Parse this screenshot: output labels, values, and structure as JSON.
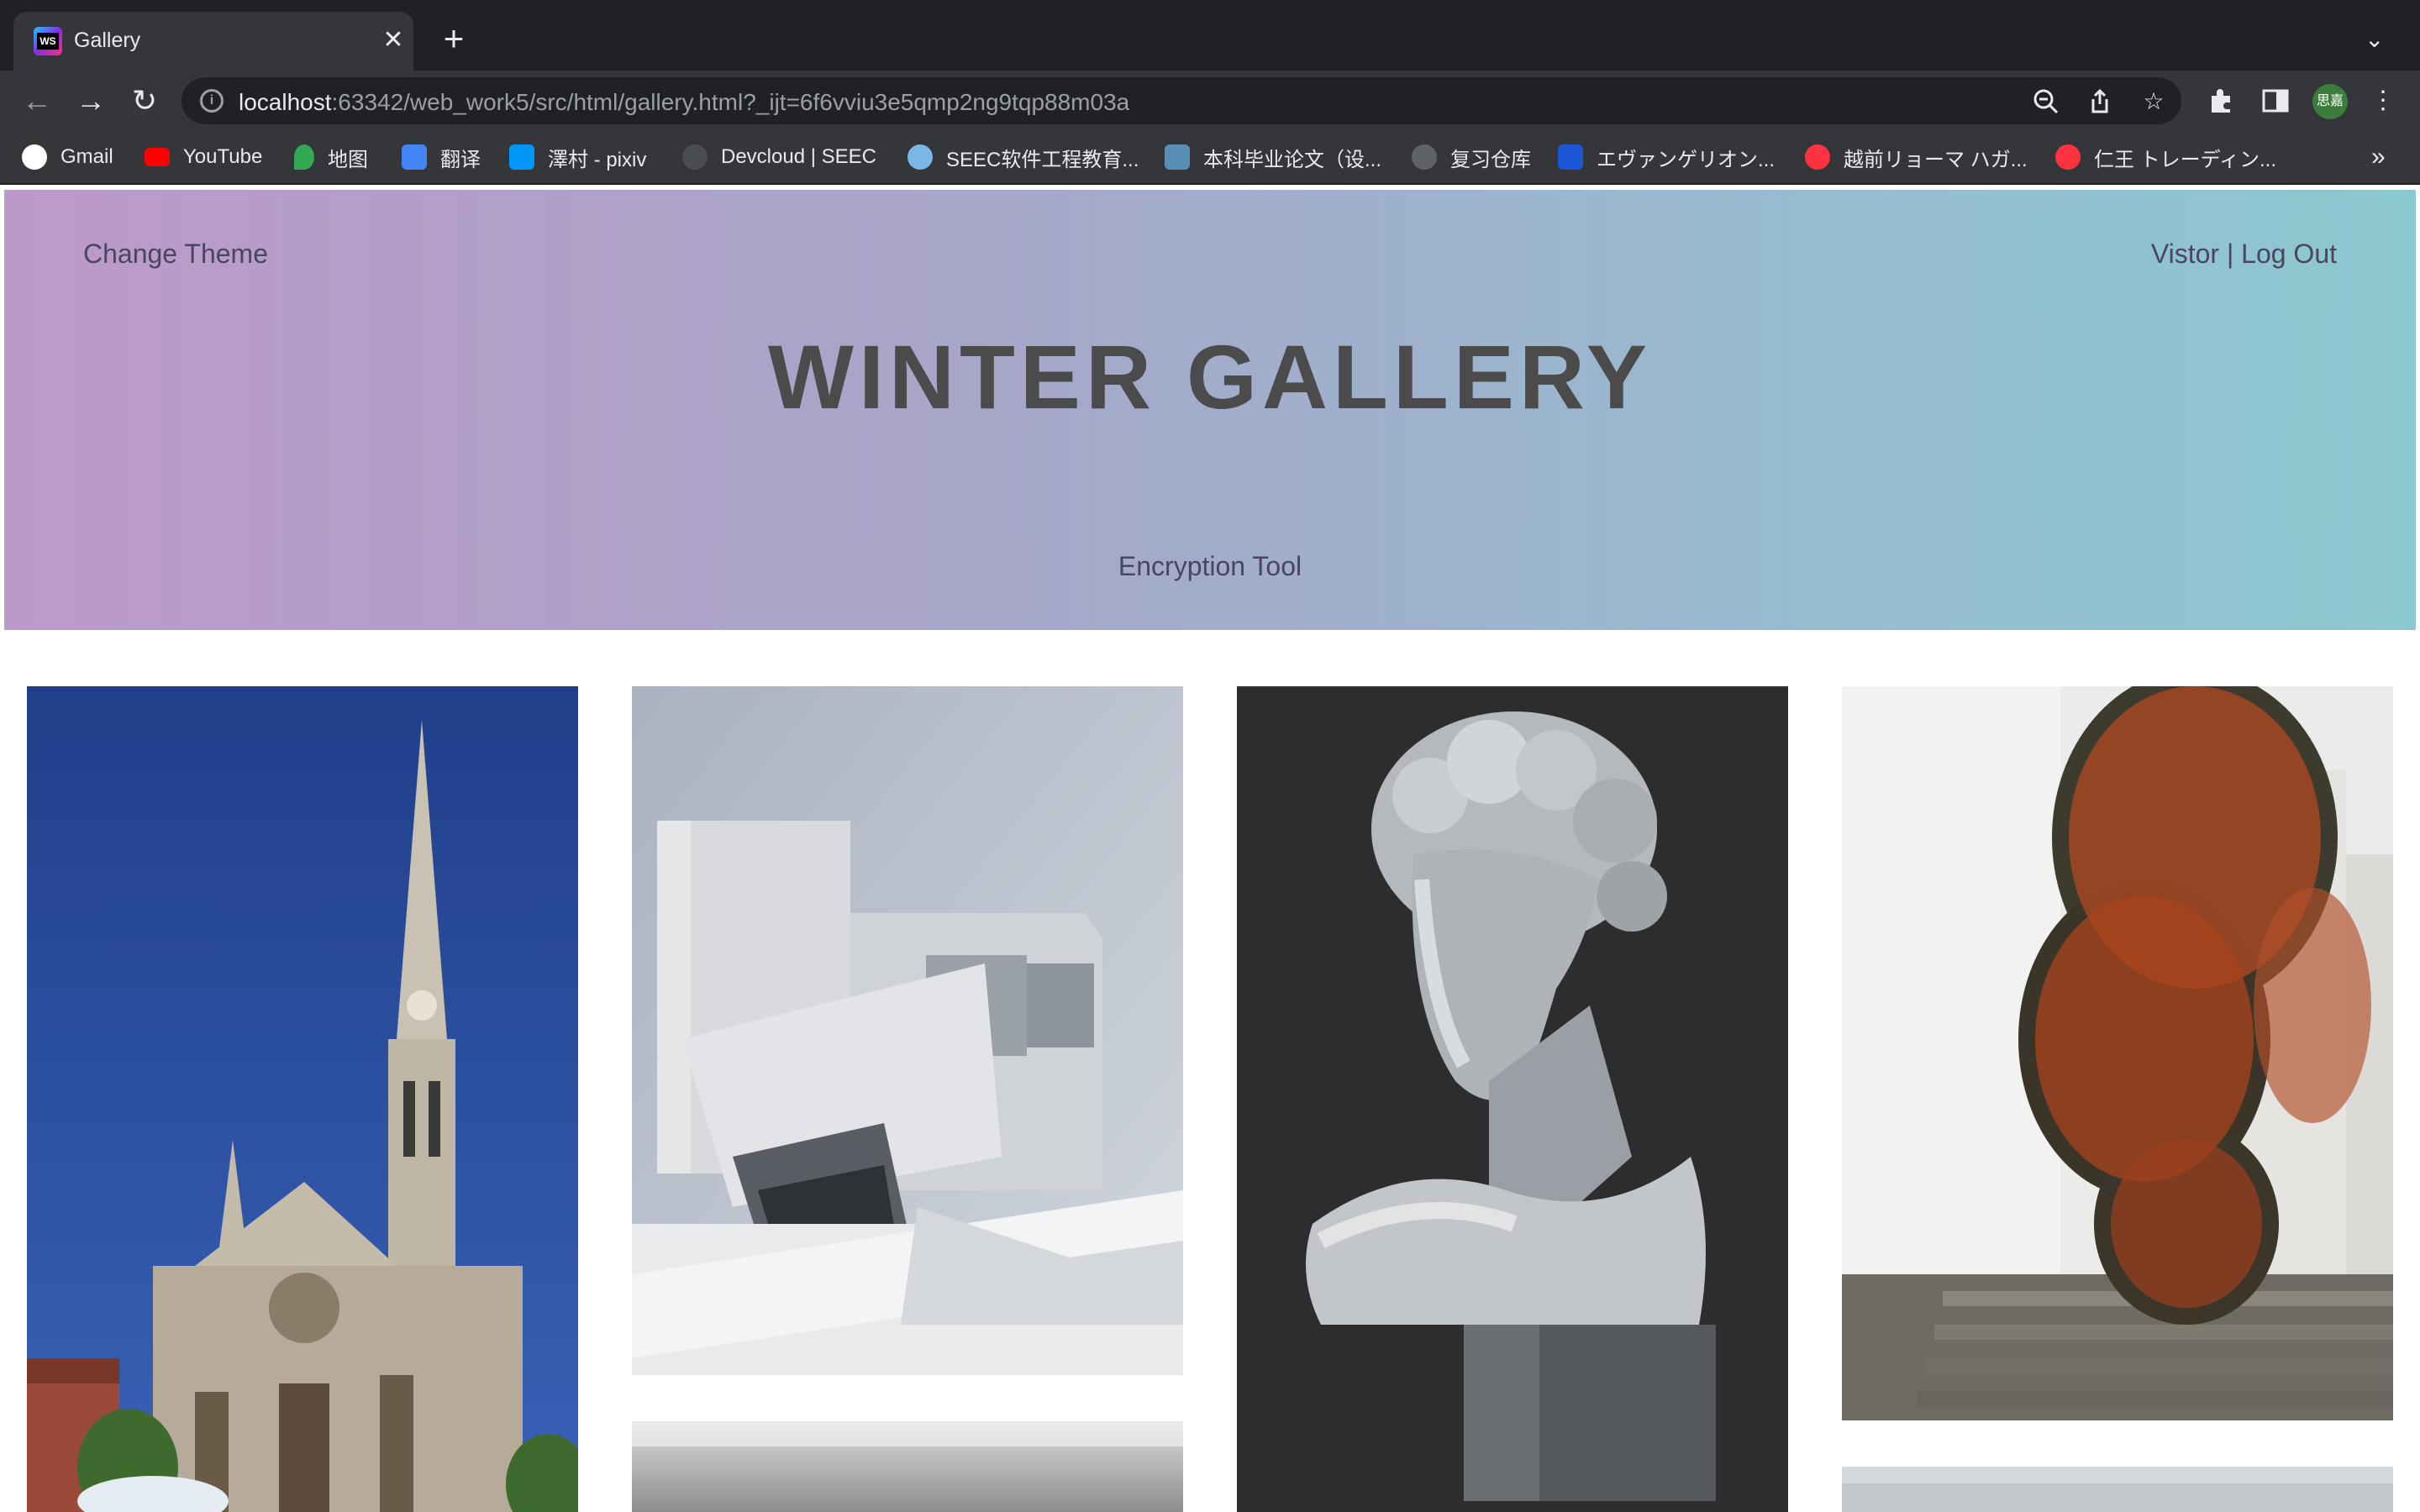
{
  "browser": {
    "tab_title": "Gallery",
    "url_host": "localhost",
    "url_rest": ":63342/web_work5/src/html/gallery.html?_ijt=6f6vviu3e5qmp2ng9tqp88m03a",
    "profile_label": "思嘉",
    "bookmarks": [
      {
        "label": "Gmail",
        "icon": "google-icon",
        "color": "#ffffff"
      },
      {
        "label": "YouTube",
        "icon": "youtube-icon",
        "color": "#ff0000"
      },
      {
        "label": "地图",
        "icon": "maps-icon",
        "color": "#34a853"
      },
      {
        "label": "翻译",
        "icon": "translate-icon",
        "color": "#4285f4"
      },
      {
        "label": "澤村 - pixiv",
        "icon": "pixiv-icon",
        "color": "#0096fa"
      },
      {
        "label": "Devcloud | SEEC",
        "icon": "cloud-icon",
        "color": "#3a3d42"
      },
      {
        "label": "SEEC软件工程教育...",
        "icon": "seec-icon",
        "color": "#79b8e6"
      },
      {
        "label": "本科毕业论文（设...",
        "icon": "school-icon",
        "color": "#5a8fb5"
      },
      {
        "label": "复习仓库",
        "icon": "github-icon",
        "color": "#24292e"
      },
      {
        "label": "エヴァンゲリオン...",
        "icon": "site-icon",
        "color": "#1a56d6"
      },
      {
        "label": "越前リョーマ ハガ...",
        "icon": "mercari-icon",
        "color": "#ff333f"
      },
      {
        "label": "仁王 トレーディン...",
        "icon": "mercari-icon",
        "color": "#ff333f"
      }
    ]
  },
  "header": {
    "change_theme": "Change Theme",
    "visitor": "Vistor | Log Out",
    "title": "WINTER GALLERY",
    "encryption": "Encryption Tool"
  },
  "gallery": {
    "images": [
      {
        "name": "cathedral-image"
      },
      {
        "name": "architecture-image"
      },
      {
        "name": "bust-sculpture-image"
      },
      {
        "name": "berries-image"
      },
      {
        "name": "water-image"
      },
      {
        "name": "misc-image"
      }
    ]
  }
}
